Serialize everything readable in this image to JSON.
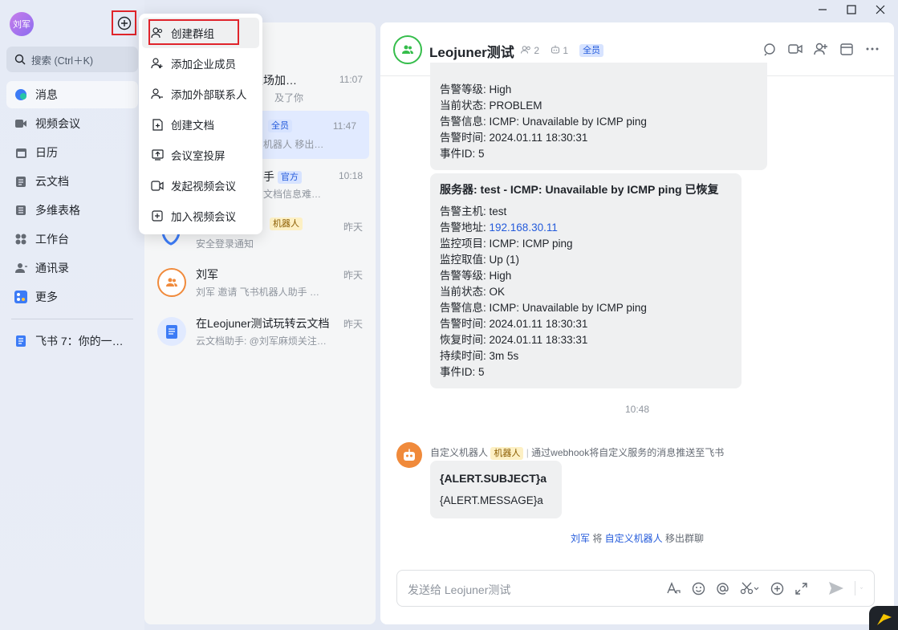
{
  "user": {
    "avatar_text": "刘军"
  },
  "search": {
    "placeholder": "搜索 (Ctrl＋K)"
  },
  "nav": [
    {
      "label": "消息",
      "icon": "message-icon",
      "active": true
    },
    {
      "label": "视频会议",
      "icon": "video-icon"
    },
    {
      "label": "日历",
      "icon": "calendar-icon"
    },
    {
      "label": "云文档",
      "icon": "doc-icon"
    },
    {
      "label": "多维表格",
      "icon": "table-icon"
    },
    {
      "label": "工作台",
      "icon": "grid-icon"
    },
    {
      "label": "通讯录",
      "icon": "contacts-icon"
    },
    {
      "label": "更多",
      "icon": "more-apps-icon"
    }
  ],
  "pinned": {
    "label": "飞书 7：你的一…"
  },
  "menu": [
    {
      "label": "创建群组",
      "icon": "group-add-icon"
    },
    {
      "label": "添加企业成员",
      "icon": "member-add-icon"
    },
    {
      "label": "添加外部联系人",
      "icon": "contact-add-icon"
    },
    {
      "label": "创建文档",
      "icon": "doc-add-icon"
    },
    {
      "label": "会议室投屏",
      "icon": "screen-share-icon"
    },
    {
      "label": "发起视频会议",
      "icon": "video-start-icon"
    },
    {
      "label": "加入视频会议",
      "icon": "join-meeting-icon"
    }
  ],
  "chats": [
    {
      "title": "的职场加…",
      "sub": "及了你",
      "time": "11:07"
    },
    {
      "title": "",
      "tag": "全员",
      "sub": "机器人 移出…",
      "time": "11:47"
    },
    {
      "title": "手",
      "tag": "官方",
      "sub": "文档信息难…",
      "time": "10:18"
    },
    {
      "title": "",
      "tag": "机器人",
      "sub": "安全登录通知",
      "time": "昨天"
    },
    {
      "title": "刘军",
      "sub": "刘军 邀请 飞书机器人助手 …",
      "time": "昨天"
    },
    {
      "title": "在Leojuner测试玩转云文档",
      "sub": "云文档助手: @刘军麻烦关注…",
      "time": "昨天"
    }
  ],
  "group": {
    "name": "Leojuner测试",
    "members": "2",
    "bots": "1",
    "tag": "全员"
  },
  "messages": {
    "first": {
      "lines": [
        "告警等级: High",
        "当前状态: PROBLEM",
        "告警信息: ICMP: Unavailable by ICMP ping",
        "告警时间: 2024.01.11 18:30:31",
        "事件ID: 5"
      ]
    },
    "second": {
      "title": "服务器: test - ICMP: Unavailable by ICMP ping 已恢复",
      "host_label": "告警主机: ",
      "host": "test",
      "addr_label": "告警地址: ",
      "addr": "192.168.30.11",
      "lines": [
        "监控项目: ICMP: ICMP ping",
        "监控取值: Up (1)",
        "告警等级: High",
        "当前状态: OK",
        "告警信息: ICMP: Unavailable by ICMP ping",
        "告警时间: 2024.01.11 18:30:31",
        "恢复时间: 2024.01.11 18:33:31",
        "持续时间: 3m 5s",
        "事件ID: 5"
      ]
    },
    "time": "10:48",
    "bot": {
      "name": "自定义机器人",
      "tag": "机器人",
      "desc": "通过webhook将自定义服务的消息推送至飞书",
      "subject": "{ALERT.SUBJECT}a",
      "message": "{ALERT.MESSAGE}a"
    },
    "system": {
      "actor": "刘军",
      "mid": " 将 ",
      "target": "自定义机器人",
      "tail": " 移出群聊"
    }
  },
  "input": {
    "placeholder": "发送给 Leojuner测试"
  },
  "colors": {
    "accent": "#245bdb",
    "highlight_box": "#e0242b",
    "group_green": "#35bd4b",
    "bot_orange": "#f08a3b"
  }
}
